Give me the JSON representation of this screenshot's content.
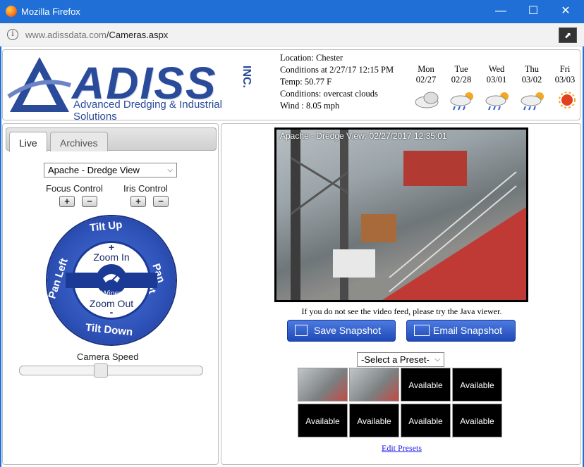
{
  "window": {
    "title": "Mozilla Firefox",
    "minimize": "—",
    "maximize": "☐",
    "close": "✕"
  },
  "urlbar": {
    "domain": "www.adissdata.com",
    "path": "/Cameras.aspx"
  },
  "logo": {
    "name": "ADISS",
    "inc": "INC.",
    "tagline": "Advanced Dredging & Industrial Solutions"
  },
  "weather": {
    "location": "Location: Chester",
    "conditions_at": "Conditions at 2/27/17 12:15 PM",
    "temp": "Temp: 50.77 F",
    "conditions": "Conditions: overcast clouds",
    "wind": "Wind : 8.05 mph",
    "days": [
      {
        "day": "Mon",
        "date": "02/27",
        "icon": "cloudy-icon"
      },
      {
        "day": "Tue",
        "date": "02/28",
        "icon": "rain-sun-icon"
      },
      {
        "day": "Wed",
        "date": "03/01",
        "icon": "rain-sun-icon"
      },
      {
        "day": "Thu",
        "date": "03/02",
        "icon": "rain-sun-icon"
      },
      {
        "day": "Fri",
        "date": "03/03",
        "icon": "sun-icon"
      }
    ]
  },
  "tabs": {
    "live": "Live",
    "archives": "Archives"
  },
  "camera_select": {
    "value": "Apache - Dredge View"
  },
  "controls": {
    "focus": "Focus Control",
    "iris": "Iris Control",
    "plus": "+",
    "minus": "−"
  },
  "joystick": {
    "tilt_up": "Tilt Up",
    "tilt_down": "Tilt Down",
    "pan_left": "Pan Left",
    "pan_right": "Pan Right",
    "zoom_in": "Zoom In",
    "zoom_out": "Zoom Out",
    "wiper": "Wiper",
    "plus": "+",
    "minus": "-"
  },
  "camera_speed": {
    "label": "Camera Speed",
    "value_fraction": 0.45
  },
  "video": {
    "caption": "Apache - Dredge View: 02/27/2017 12:35:01"
  },
  "note": "If you do not see the video feed, please try the Java viewer.",
  "buttons": {
    "save": "Save Snapshot",
    "email": "Email Snapshot"
  },
  "preset_select": {
    "value": "-Select a Preset-"
  },
  "presets": [
    "",
    "",
    "Available",
    "Available",
    "Available",
    "Available",
    "Available",
    "Available"
  ],
  "edit_presets": "Edit Presets"
}
